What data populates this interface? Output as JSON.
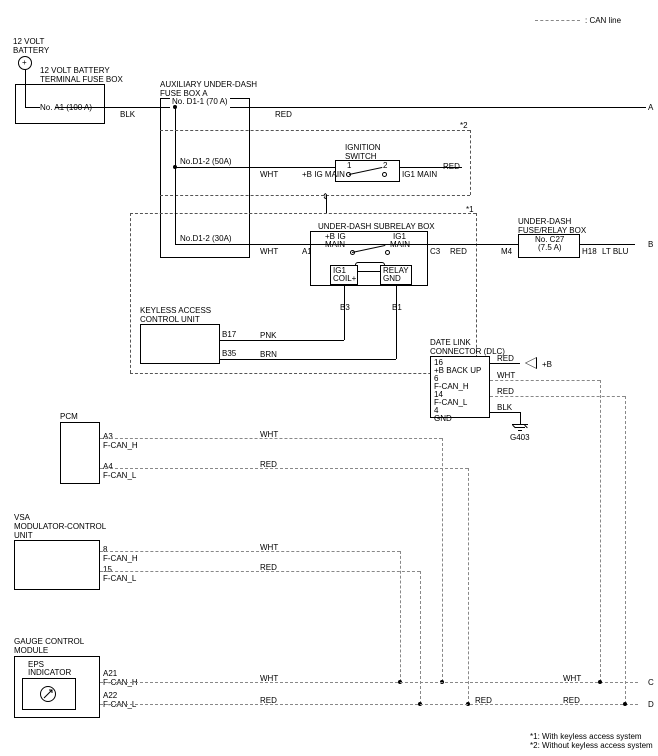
{
  "legend": {
    "can_line": ": CAN line"
  },
  "battery": {
    "title1": "12 VOLT",
    "title2": "BATTERY",
    "terminal_label1": "12 VOLT BATTERY",
    "terminal_label2": "TERMINAL FUSE BOX",
    "fuse": "No. A1 (100 A)",
    "wire_out": "BLK"
  },
  "aux_fuse_box": {
    "title1": "AUXILIARY UNDER-DASH",
    "title2": "FUSE BOX A",
    "fuse1": "No. D1-1 (70 A)",
    "fuse2": "No.D1-2 (50A)",
    "fuse3": "No.D1-2 (30A)",
    "wire_red": "RED",
    "wire_wht1": "WHT",
    "wire_wht2": "WHT",
    "pin_a1": "A1"
  },
  "ignition_switch": {
    "title1": "IGNITION",
    "title2": "SWITCH",
    "pin1": "1",
    "pin2": "2",
    "label_in": "+B IG MAIN",
    "label_out": "IG1 MAIN",
    "wire_out": "RED"
  },
  "subrelay_box": {
    "title": "UNDER-DASH SUBRELAY BOX",
    "label_bigin": "+B IG",
    "label_bigin2": "MAIN",
    "label_ig1": "IG1",
    "label_ig12": "MAIN",
    "pin_c3": "C3",
    "wire_out": "RED",
    "ig1_coil": "IG1",
    "ig1_coil2": "COIL+",
    "relay_gnd": "RELAY",
    "relay_gnd2": "GND",
    "pin_b3": "B3",
    "pin_b1": "B1"
  },
  "underdash_fuse_relay": {
    "title1": "UNDER-DASH",
    "title2": "FUSE/RELAY BOX",
    "pin_m4": "M4",
    "fuse": "No. C27",
    "fuse2": "(7.5 A)",
    "pin_h18": "H18",
    "wire_out": "LT BLU",
    "arrow_out": "B"
  },
  "keyless": {
    "title1": "KEYLESS ACCESS",
    "title2": "CONTROL UNIT",
    "pin_b17": "B17",
    "wire_pnk": "PNK",
    "pin_b35": "B35",
    "wire_brn": "BRN"
  },
  "dlc": {
    "title1": "DATE LINK",
    "title2": "CONNECTOR (DLC)",
    "pin16": "16",
    "pin16_label": "+B BACK UP",
    "pin6": "6",
    "pin6_label": "F-CAN_H",
    "pin14": "14",
    "pin14_label": "F-CAN_L",
    "pin4": "4",
    "pin4_label": "GND",
    "wire_red16": "RED",
    "wire_wht6": "WHT",
    "wire_red14": "RED",
    "wire_blk4": "BLK",
    "b_label": "+B",
    "ground": "G403"
  },
  "pcm": {
    "title": "PCM",
    "pin_a3": "A3",
    "pin_a3_label": "F-CAN_H",
    "pin_a4": "A4",
    "pin_a4_label": "F-CAN_L",
    "wire_wht": "WHT",
    "wire_red": "RED"
  },
  "vsa": {
    "title1": "VSA",
    "title2": "MODULATOR-CONTROL",
    "title3": "UNIT",
    "pin8": "8",
    "pin8_label": "F-CAN_H",
    "pin15": "15",
    "pin15_label": "F-CAN_L",
    "wire_wht": "WHT",
    "wire_red": "RED"
  },
  "gauge": {
    "title1": "GAUGE CONTROL",
    "title2": "MODULE",
    "eps_title": "EPS",
    "eps_title2": "INDICATOR",
    "pin_a21": "A21",
    "pin_a21_label": "F-CAN_H",
    "pin_a22": "A22",
    "pin_a22_label": "F-CAN_L",
    "wire_wht": "WHT",
    "wire_red": "RED",
    "wire_wht_r": "WHT",
    "wire_red_r": "RED",
    "arrow_c": "C",
    "arrow_d": "D"
  },
  "arrows": {
    "a": "A"
  },
  "notes": {
    "note1": "*1: With keyless access system",
    "note2": "*2: Without keyless access system",
    "star1": "*1",
    "star2": "*2"
  },
  "chart_data": {
    "type": "wiring-diagram",
    "title": "Electrical wiring diagram (keyless access / CAN / EPS)",
    "components": [
      {
        "id": "battery",
        "label": "12 VOLT BATTERY"
      },
      {
        "id": "batt_terminal_fuse_box",
        "label": "12 VOLT BATTERY TERMINAL FUSE BOX",
        "fuses": [
          "No. A1 (100 A)"
        ]
      },
      {
        "id": "aux_fuse_box_a",
        "label": "AUXILIARY UNDER-DASH FUSE BOX A",
        "fuses": [
          "No. D1-1 (70 A)",
          "No.D1-2 (50A)",
          "No.D1-2 (30A)"
        ]
      },
      {
        "id": "ignition_switch",
        "label": "IGNITION SWITCH",
        "pins": [
          "1",
          "2"
        ]
      },
      {
        "id": "underdash_subrelay_box",
        "label": "UNDER-DASH SUBRELAY BOX",
        "pins": [
          "A1",
          "C3",
          "B3",
          "B1"
        ]
      },
      {
        "id": "underdash_fuse_relay_box",
        "label": "UNDER-DASH FUSE/RELAY BOX",
        "fuses": [
          "No. C27 (7.5 A)"
        ],
        "pins": [
          "M4",
          "H18"
        ]
      },
      {
        "id": "keyless_access_cu",
        "label": "KEYLESS ACCESS CONTROL UNIT",
        "pins": [
          "B17",
          "B35"
        ]
      },
      {
        "id": "dlc",
        "label": "DATE LINK CONNECTOR (DLC)",
        "pins": [
          "16 +B BACK UP",
          "6 F-CAN_H",
          "14 F-CAN_L",
          "4 GND"
        ]
      },
      {
        "id": "pcm",
        "label": "PCM",
        "pins": [
          "A3 F-CAN_H",
          "A4 F-CAN_L"
        ]
      },
      {
        "id": "vsa",
        "label": "VSA MODULATOR-CONTROL UNIT",
        "pins": [
          "8 F-CAN_H",
          "15 F-CAN_L"
        ]
      },
      {
        "id": "gauge_control_module",
        "label": "GAUGE CONTROL MODULE",
        "indicators": [
          "EPS INDICATOR"
        ],
        "pins": [
          "A21 F-CAN_H",
          "A22 F-CAN_L"
        ]
      }
    ],
    "wires": [
      {
        "from": "batt_terminal_fuse_box",
        "to": "aux_fuse_box_a",
        "color": "BLK"
      },
      {
        "from": "aux_fuse_box_a.D1-1",
        "to": "A",
        "color": "RED"
      },
      {
        "from": "aux_fuse_box_a.D1-2(50A)",
        "to": "ignition_switch.1",
        "color": "WHT",
        "note": "*2"
      },
      {
        "from": "ignition_switch.2",
        "to": "RED",
        "color": "RED"
      },
      {
        "from": "aux_fuse_box_a.D1-2(30A)",
        "to": "underdash_subrelay_box.A1",
        "color": "WHT",
        "note": "*1"
      },
      {
        "from": "underdash_subrelay_box.C3",
        "to": "underdash_fuse_relay_box.M4",
        "color": "RED"
      },
      {
        "from": "underdash_fuse_relay_box.H18",
        "to": "B",
        "color": "LT BLU"
      },
      {
        "from": "keyless_access_cu.B17",
        "to": "underdash_subrelay_box.B3",
        "color": "PNK"
      },
      {
        "from": "keyless_access_cu.B35",
        "to": "underdash_subrelay_box.B1",
        "color": "BRN"
      },
      {
        "from": "dlc.16",
        "to": "+B",
        "color": "RED"
      },
      {
        "from": "dlc.6",
        "to": "CAN_H_bus",
        "color": "WHT"
      },
      {
        "from": "dlc.14",
        "to": "CAN_L_bus",
        "color": "RED"
      },
      {
        "from": "dlc.4",
        "to": "G403",
        "color": "BLK"
      },
      {
        "from": "pcm.A3",
        "to": "CAN_H_bus",
        "color": "WHT"
      },
      {
        "from": "pcm.A4",
        "to": "CAN_L_bus",
        "color": "RED"
      },
      {
        "from": "vsa.8",
        "to": "CAN_H_bus",
        "color": "WHT"
      },
      {
        "from": "vsa.15",
        "to": "CAN_L_bus",
        "color": "RED"
      },
      {
        "from": "gauge_control_module.A21",
        "to": "C",
        "color": "WHT"
      },
      {
        "from": "gauge_control_module.A22",
        "to": "D",
        "color": "RED"
      }
    ],
    "grounds": [
      "G403"
    ],
    "offpage": [
      "A",
      "B",
      "C",
      "D"
    ],
    "notes": [
      "*1: With keyless access system",
      "*2: Without keyless access system"
    ]
  }
}
